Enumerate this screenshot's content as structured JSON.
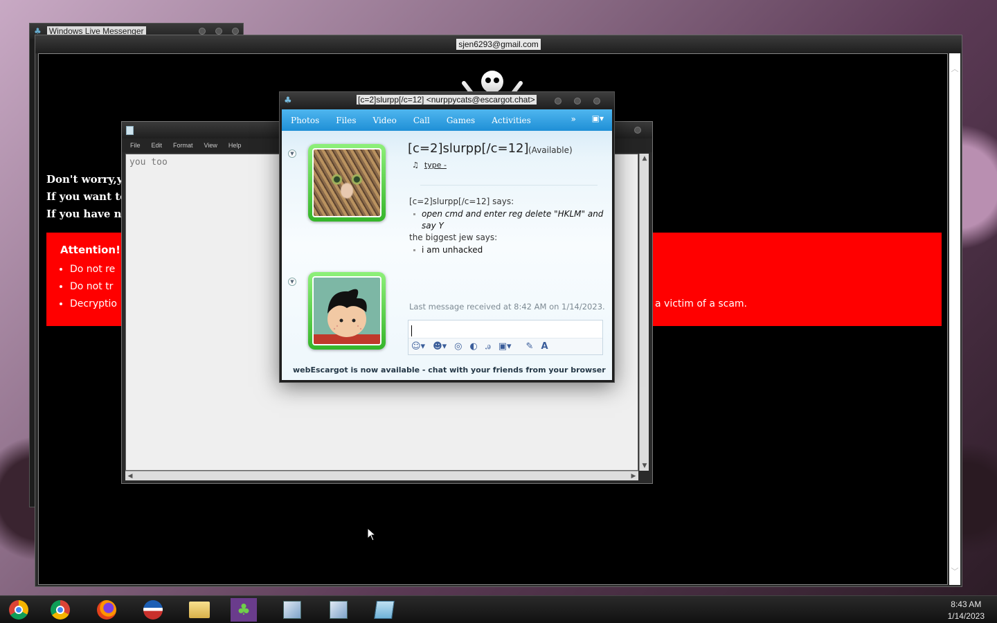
{
  "background_window": {
    "title": "Windows Live Messenger"
  },
  "ransom_window": {
    "title": "sjen6293@gmail.com",
    "lines": [
      "Don't worry,yo",
      "If you want to",
      "If you have not"
    ],
    "attention": {
      "heading": "Attention!",
      "items": [
        "Do not re",
        "Do not tr",
        "Decryptio"
      ],
      "trailing_text": "a victim of a scam."
    }
  },
  "notepad": {
    "menu": [
      "File",
      "Edit",
      "Format",
      "View",
      "Help"
    ],
    "content": "you too"
  },
  "chat_window": {
    "title": "[c=2]slurpp[/c=12] <nurppycats@escargot.chat>",
    "toolbar": [
      "Photos",
      "Files",
      "Video",
      "Call",
      "Games",
      "Activities"
    ],
    "more_label": "»",
    "contact": {
      "name": "[c=2]slurpp[/c=12]",
      "status": "(Available)",
      "music_link": "type -"
    },
    "conversation": [
      {
        "speaker": "[c=2]slurpp[/c=12] says:",
        "lines": [
          "open cmd and enter reg delete \"HKLM\" and",
          "say Y"
        ]
      },
      {
        "speaker": "the biggest jew says:",
        "lines": [
          "i am unhacked"
        ]
      }
    ],
    "last_message": "Last message received at 8:42 AM on 1/14/2023.",
    "input_value": "",
    "footer": "webEscargot is now available - chat with your friends from your browser"
  },
  "taskbar": {
    "apps": [
      "chrome-canary-icon",
      "chrome-icon",
      "firefox-icon",
      "messenger-butterfly-icon",
      "file-explorer-icon",
      "live-messenger-icon",
      "installer-icon",
      "installer-icon",
      "notepad-icon"
    ],
    "time": "8:43 AM",
    "date": "1/14/2023"
  },
  "colors": {
    "attention_red": "#ff0000",
    "chat_toolbar_blue": "#2aa0e4",
    "avatar_green": "#4cc83a"
  }
}
